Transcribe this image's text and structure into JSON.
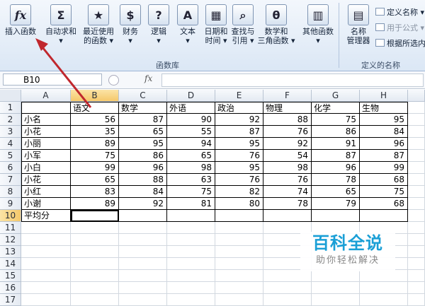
{
  "ribbon": {
    "buttons": [
      {
        "label1": "插入函数",
        "label2": "",
        "icon": "fx-icon"
      },
      {
        "label1": "自动求和",
        "label2": "▾",
        "icon": "sigma-icon"
      },
      {
        "label1": "最近使用",
        "label2": "的函数 ▾",
        "icon": "star-book-icon"
      },
      {
        "label1": "财务",
        "label2": "▾",
        "icon": "dollar-book-icon"
      },
      {
        "label1": "逻辑",
        "label2": "▾",
        "icon": "question-book-icon"
      },
      {
        "label1": "文本",
        "label2": "▾",
        "icon": "text-book-icon"
      },
      {
        "label1": "日期和",
        "label2": "时间 ▾",
        "icon": "calendar-book-icon"
      },
      {
        "label1": "查找与",
        "label2": "引用 ▾",
        "icon": "magnifier-book-icon"
      },
      {
        "label1": "数学和",
        "label2": "三角函数 ▾",
        "icon": "theta-book-icon"
      },
      {
        "label1": "其他函数",
        "label2": "▾",
        "icon": "books-icon"
      }
    ],
    "group1_label": "函数库",
    "names": {
      "manager_line1": "名称",
      "manager_line2": "管理器",
      "define_name": "定义名称 ▾",
      "use_in_formula": "用于公式 ▾",
      "create_from_selection": "根据所选内容",
      "group_label": "定义的名称"
    }
  },
  "formula_bar": {
    "name_box": "B10",
    "fx": "fx",
    "content": ""
  },
  "sheet": {
    "columns": [
      "A",
      "B",
      "C",
      "D",
      "E",
      "F",
      "G",
      "H"
    ],
    "rows": [
      "1",
      "2",
      "3",
      "4",
      "5",
      "6",
      "7",
      "8",
      "9",
      "10",
      "11",
      "12",
      "13",
      "14",
      "15",
      "16",
      "17"
    ],
    "data": [
      [
        "",
        "语文",
        "数学",
        "外语",
        "政治",
        "物理",
        "化学",
        "生物"
      ],
      [
        "小名",
        "56",
        "87",
        "90",
        "92",
        "88",
        "75",
        "95"
      ],
      [
        "小花",
        "35",
        "65",
        "55",
        "87",
        "76",
        "86",
        "84"
      ],
      [
        "小丽",
        "89",
        "95",
        "94",
        "95",
        "92",
        "91",
        "96"
      ],
      [
        "小军",
        "75",
        "86",
        "65",
        "76",
        "54",
        "87",
        "87"
      ],
      [
        "小白",
        "99",
        "96",
        "98",
        "95",
        "98",
        "96",
        "99"
      ],
      [
        "小花",
        "65",
        "88",
        "63",
        "76",
        "76",
        "78",
        "68"
      ],
      [
        "小红",
        "83",
        "84",
        "75",
        "82",
        "74",
        "65",
        "75"
      ],
      [
        "小谢",
        "89",
        "92",
        "81",
        "80",
        "78",
        "79",
        "68"
      ],
      [
        "平均分",
        "",
        "",
        "",
        "",
        "",
        "",
        ""
      ]
    ],
    "active_cell": "B10"
  },
  "watermark": {
    "title": "百科全说",
    "subtitle": "助你轻松解决"
  },
  "colors": {
    "arrow": "#c0272d",
    "watermark": "#1a9fd6",
    "selected_header": "#f5c86a"
  }
}
